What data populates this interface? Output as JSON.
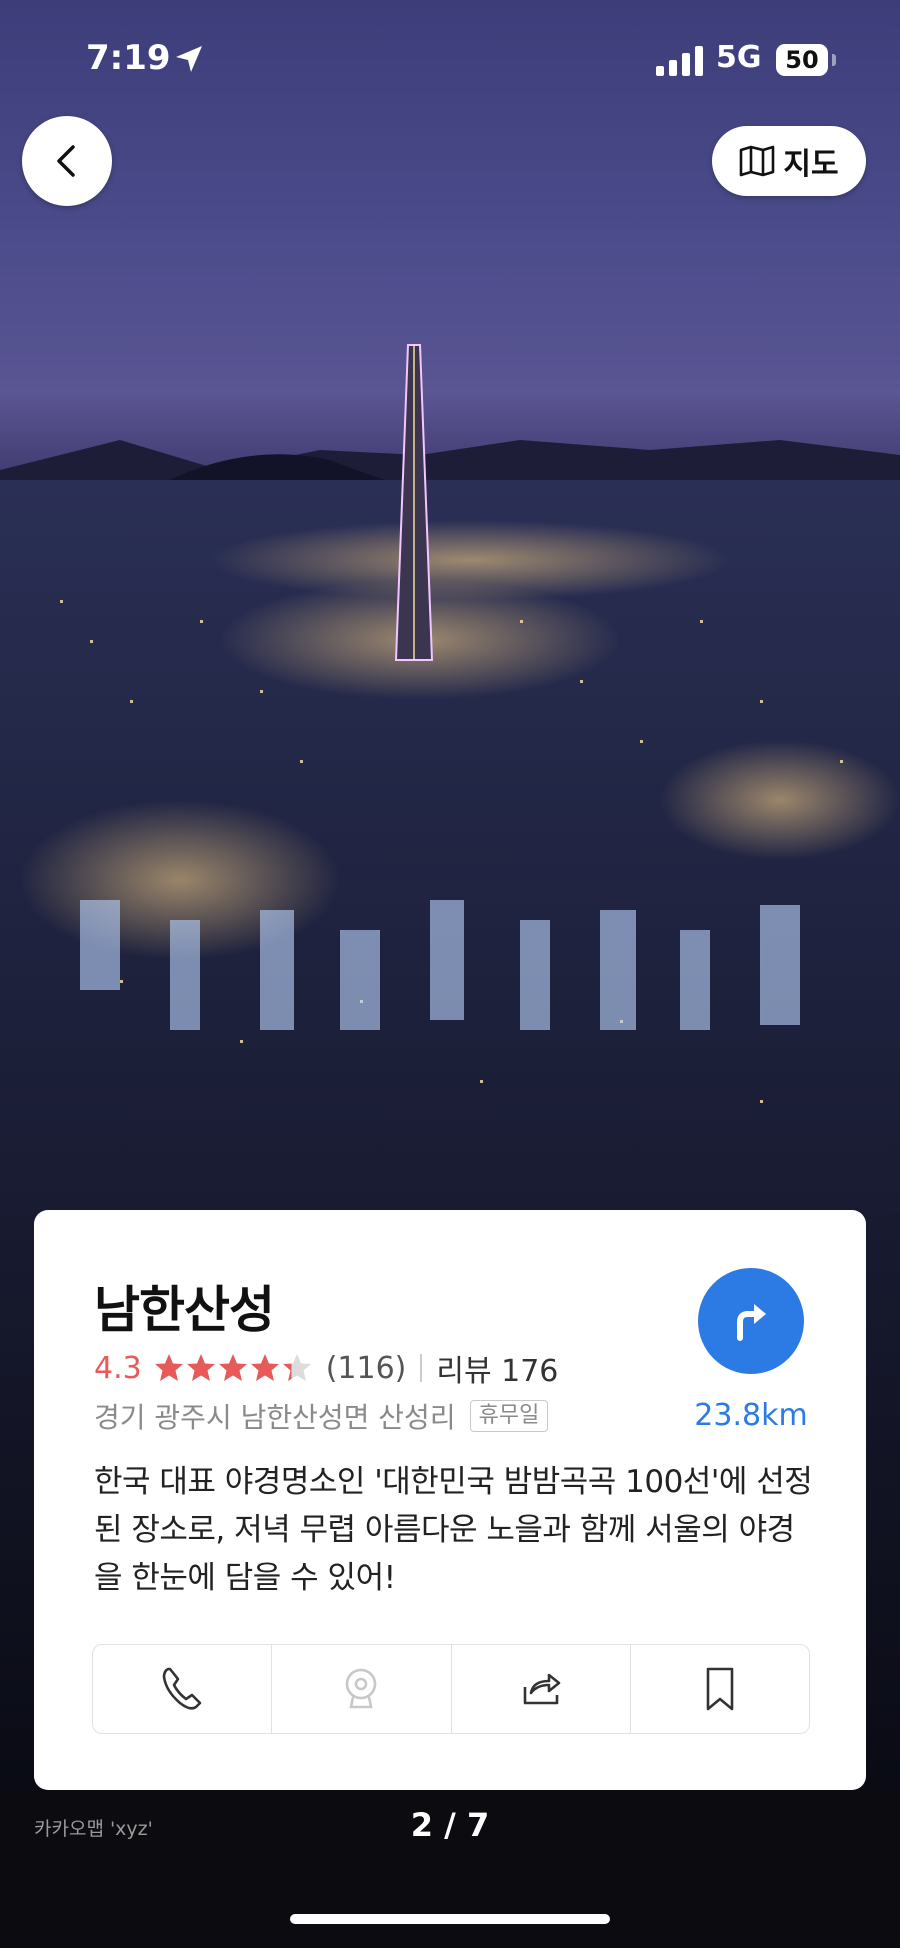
{
  "status_bar": {
    "time": "7:19",
    "network": "5G",
    "battery": "50"
  },
  "header": {
    "map_label": "지도"
  },
  "card": {
    "name": "남한산성",
    "rating": "4.3",
    "rating_value": 4.3,
    "rating_count": "(116)",
    "reviews": "리뷰 176",
    "address": "경기 광주시 남한산성면 산성리",
    "badge": "휴무일",
    "distance": "23.8km",
    "description": "한국 대표 야경명소인 '대한민국 밤밤곡곡 100선'에 선정된 장소로, 저녁 무렵 아름다운 노을과 함께 서울의 야경을 한눈에 담을 수 있어!",
    "accent_color": "#2c7be5",
    "rating_color": "#e85a5a"
  },
  "footer": {
    "credit": "카카오맵 'xyz'",
    "pager": "2 / 7"
  }
}
